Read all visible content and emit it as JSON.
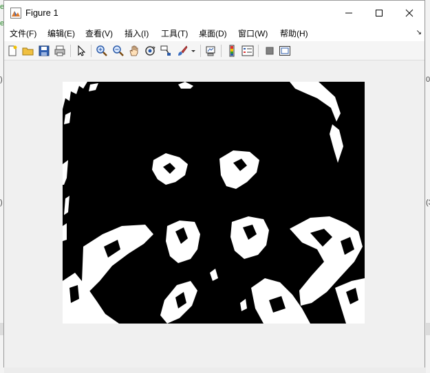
{
  "background": {
    "fragments": [
      ")",
      ")",
      "e",
      "e",
      "0",
      "(3"
    ]
  },
  "window": {
    "title": "Figure 1",
    "icon": "matlab-figure-icon",
    "controls": [
      "minimize-icon",
      "maximize-icon",
      "close-icon"
    ]
  },
  "menu": {
    "items": [
      "文件(F)",
      "编辑(E)",
      "查看(V)",
      "插入(I)",
      "工具(T)",
      "桌面(D)",
      "窗口(W)",
      "帮助(H)"
    ],
    "dock_glyph": "↘"
  },
  "toolbar": {
    "buttons": [
      "new-figure-icon",
      "open-file-icon",
      "save-icon",
      "print-icon",
      "pointer-icon",
      "zoom-in-icon",
      "zoom-out-icon",
      "pan-hand-icon",
      "rotate-3d-icon",
      "data-cursor-icon",
      "brush-icon",
      "brush-dropdown-icon",
      "link-plot-icon",
      "colorbar-icon",
      "legend-icon",
      "hide-plot-tools-icon",
      "show-plot-tools-icon"
    ]
  },
  "image": {
    "description_type": "binary-thresholded-image",
    "colors": {
      "background": "#000000",
      "foreground": "#ffffff"
    }
  }
}
